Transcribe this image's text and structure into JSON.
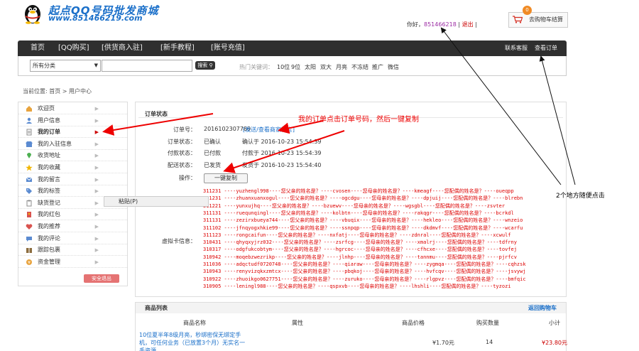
{
  "header": {
    "logo_title": "起点QQ号码批发商城",
    "logo_url": "www.851466219.com",
    "hello_prefix": "你好，",
    "user_qq": "851466218",
    "separator": "|",
    "logout": "退出",
    "cart_count": "0",
    "cart_label": "去购物车结算"
  },
  "nav": {
    "items": [
      "首页",
      "[QQ购买]",
      "[供货商入驻]",
      "[新手教程]",
      "[账号充值]"
    ],
    "right": [
      "联系客服",
      "查看订单"
    ]
  },
  "search": {
    "category": "所有分类",
    "button": "搜索",
    "hot_label": "热门关键词：",
    "hot": [
      "10位",
      "9位",
      "太阳",
      "双大",
      "月亮",
      "不冻结",
      "推广",
      "微信"
    ]
  },
  "breadcrumb": {
    "prefix": "当前位置:",
    "home": "首页",
    "sep": ">",
    "current": "用户中心"
  },
  "sidebar": {
    "items": [
      {
        "label": "欢迎页",
        "icon": "home-icon",
        "color": "#e8a33d"
      },
      {
        "label": "用户信息",
        "icon": "user-icon",
        "color": "#5b8bd1"
      },
      {
        "label": "我的订单",
        "icon": "document-icon",
        "color": "#8c8c8c"
      },
      {
        "label": "我的入驻信息",
        "icon": "store-icon",
        "color": "#5b8bd1"
      },
      {
        "label": "收货地址",
        "icon": "location-icon",
        "color": "#4caf50"
      },
      {
        "label": "我的收藏",
        "icon": "star-icon",
        "color": "#f2b600"
      },
      {
        "label": "我的留言",
        "icon": "message-icon",
        "color": "#5b8bd1"
      },
      {
        "label": "我的标签",
        "icon": "tag-icon",
        "color": "#5b8bd1"
      },
      {
        "label": "缺货登记",
        "icon": "clipboard-icon",
        "color": "#8c8c8c"
      },
      {
        "label": "我的红包",
        "icon": "redpacket-icon",
        "color": "#d9534f"
      },
      {
        "label": "我的推荐",
        "icon": "recommend-icon",
        "color": "#d9534f"
      },
      {
        "label": "我的评论",
        "icon": "comment-icon",
        "color": "#5b8bd1"
      },
      {
        "label": "跟踪包裹",
        "icon": "package-icon",
        "color": "#8c6d3f"
      },
      {
        "label": "资金管理",
        "icon": "money-icon",
        "color": "#e8a33d"
      }
    ],
    "safe_logout": "安全退出"
  },
  "context_menu": {
    "paste": "粘贴(P)"
  },
  "order": {
    "title": "订单状态",
    "order_no_label": "订单号：",
    "order_no": "2016102307789",
    "order_link": "[发送/查看商家留言]",
    "status_label": "订单状态：",
    "status": "已确认",
    "status_time": "确认于 2016-10-23 15:54:39",
    "pay_label": "付款状态：",
    "pay": "已付款",
    "pay_time": "付款于 2016-10-23 15:54:39",
    "ship_label": "配送状态：",
    "ship": "已发货",
    "ship_time": "发货于 2016-10-23 15:54:40",
    "op_label": "操作：",
    "copy_button": "一键复制",
    "card_label": "虚拟卡信息：",
    "cards": [
      "311231 ----yuzhengl998----您父亲的姓名是？----cvosen----您母亲的姓名是？----kmeagf----您配偶的姓名是？----oueqpp",
      "311231 ----zhuanxuanxogul----您父亲的姓名是？----ogcdgu----您母亲的姓名是？----dpjuij----您配偶的姓名是？----blrebn",
      "311221 ----yunxujhq----您父亲的姓名是？----bzuewv----您母亲的姓名是？----wgsgbl----您配偶的姓名是？----zsvter",
      "311131 ----ruequnqingl----您父亲的姓名是？----kolbtn----您母亲的姓名是？----rakqgr----您配偶的姓名是？----bcrkdl",
      "311131 ----zezirxbueya744----您父亲的姓名是？----vbuqix----您母亲的姓名是？----hekleo----您配偶的姓名是？----wnzeio",
      "311102 ----jfnqyogxhkie99----您父亲的姓名是？----ssnpqp----您母亲的姓名是？----dkdmvf----您配偶的姓名是？----wcarfu",
      "311123 ----rongcaifun----您父亲的姓名是？----nxfatj----您母亲的姓名是？----zdnral----您配偶的姓名是？----xcwulf",
      "310431 ----qhyqxyjrz032----您父亲的姓名是？----zsrfcg----您母亲的姓名是？----xmalrj----您配偶的姓名是？----tdfrny",
      "310317 ----odgfukcobtym----您父亲的姓名是？----hgrcoc----您母亲的姓名是？----cfhcxe----您配偶的姓名是？----tovfej",
      "310942 ----moqebzwezrikp----您父亲的姓名是？----jlnhp----您母亲的姓名是？----tannmu----您配偶的姓名是？----pjrfcv",
      "311036 ----adqctudf0720748----您父亲的姓名是？----qiaraw----您母亲的姓名是？----zygmqa----您配偶的姓名是？----cqhzsk",
      "310943 ----renyvizqkxzmtcx----您父亲的姓名是？----pbqkoj----您母亲的姓名是？----hvfcqv----您配偶的姓名是？----jsvywj",
      "310922 ----zhuoikgo0627751----您父亲的姓名是？----zuruko----您母亲的姓名是？----rlgpvz----您配偶的姓名是？----bmfqic",
      "310905 ----leningl988----您父亲的姓名是？----qspxvb----您母亲的姓名是？----lhshli----您配偶的姓名是？----tyzozi"
    ]
  },
  "annotations": {
    "note1": "我的订单点击订单号码，然后一键复制",
    "note2": "2个地方随便点击"
  },
  "products": {
    "title": "商品列表",
    "back_to_cart": "返回购物车",
    "columns": [
      "商品名称",
      "属性",
      "商品价格",
      "购买数量",
      "小计"
    ],
    "rows": [
      {
        "name": "10位夏半年8级月亮，秒绑密保无绑定手机，可任何业务（已放置3个月）无实名一手资源",
        "attr": "",
        "price": "¥1.70元",
        "qty": "14",
        "subtotal": "¥23.80元"
      }
    ]
  }
}
